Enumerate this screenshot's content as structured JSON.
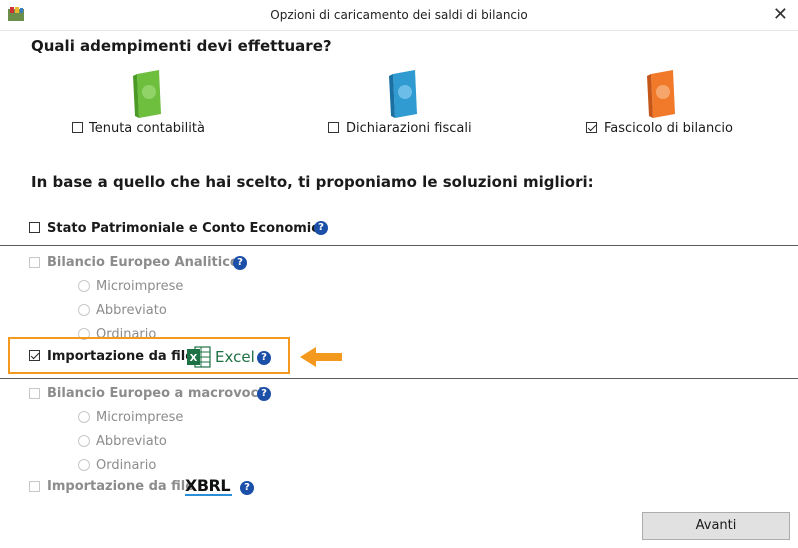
{
  "window": {
    "title": "Opzioni di caricamento dei saldi di bilancio"
  },
  "section1": {
    "question": "Quali adempimenti devi effettuare?",
    "options": [
      {
        "label": "Tenuta contabilità",
        "checked": false,
        "color": "#6ebf3d"
      },
      {
        "label": "Dichiarazioni fiscali",
        "checked": false,
        "color": "#2f9bd1"
      },
      {
        "label": "Fascicolo di bilancio",
        "checked": true,
        "color": "#f07a2a"
      }
    ]
  },
  "section2": {
    "question": "In base a quello che hai scelto, ti proponiamo le soluzioni migliori:",
    "stato": {
      "label": "Stato Patrimoniale e Conto Economico",
      "checked": false
    },
    "analitico": {
      "label": "Bilancio Europeo Analitico",
      "checked": false,
      "enabled": false,
      "radios": [
        "Microimprese",
        "Abbreviato",
        "Ordinario"
      ]
    },
    "import_excel": {
      "label": "Importazione da file",
      "checked": true,
      "logo_text": "Excel"
    },
    "macrovoci": {
      "label": "Bilancio Europeo a macrovoci",
      "checked": false,
      "enabled": false,
      "radios": [
        "Microimprese",
        "Abbreviato",
        "Ordinario"
      ]
    },
    "import_xbrl": {
      "label": "Importazione da file",
      "checked": false,
      "enabled": false,
      "logo_text": "XBRL"
    }
  },
  "help_glyph": "?",
  "close_glyph": "✕",
  "footer": {
    "next_label": "Avanti"
  },
  "colors": {
    "highlight": "#f39a1e",
    "help": "#1c4fa8",
    "excel": "#1e7145"
  }
}
